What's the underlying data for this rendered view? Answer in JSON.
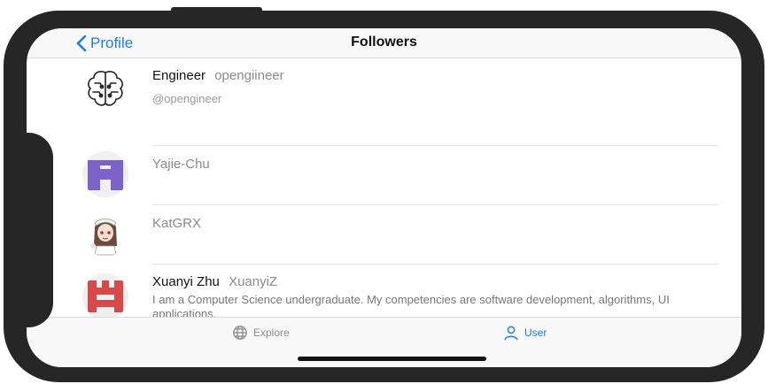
{
  "navbar": {
    "back_label": "Profile",
    "title": "Followers"
  },
  "followers": [
    {
      "name": "Engineer",
      "login": "opengiineer",
      "subtitle": "@opengineer",
      "avatar": "brain-icon-avatar"
    },
    {
      "name": "",
      "login": "Yajie-Chu",
      "subtitle": "",
      "avatar": "purple-identicon-avatar"
    },
    {
      "name": "",
      "login": "KatGRX",
      "subtitle": "",
      "avatar": "anime-girl-avatar"
    },
    {
      "name": "Xuanyi Zhu",
      "login": "XuanyiZ",
      "bio": "I am a Computer Science undergraduate. My competencies are software development, algorithms, UI applications.",
      "avatar": "red-identicon-avatar"
    }
  ],
  "tabbar": {
    "explore_label": "Explore",
    "user_label": "User",
    "active_tab": "User"
  },
  "colors": {
    "accent": "#1a7cf5",
    "frame": "#262626",
    "purple_identicon": "#7b63c9",
    "red_identicon": "#d9494a"
  }
}
